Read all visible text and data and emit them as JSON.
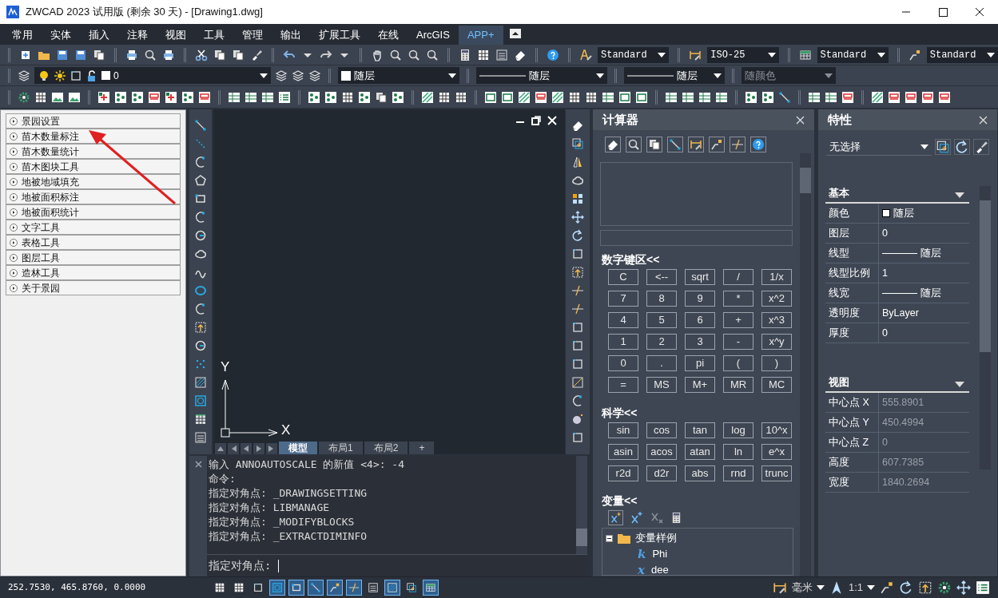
{
  "window": {
    "title": "ZWCAD 2023 试用版 (剩余 30 天) - [Drawing1.dwg]"
  },
  "ribbon_tabs": [
    {
      "label": "常用",
      "selected": false
    },
    {
      "label": "实体",
      "selected": false
    },
    {
      "label": "插入",
      "selected": false
    },
    {
      "label": "注释",
      "selected": false
    },
    {
      "label": "视图",
      "selected": false
    },
    {
      "label": "工具",
      "selected": false
    },
    {
      "label": "管理",
      "selected": false
    },
    {
      "label": "输出",
      "selected": false
    },
    {
      "label": "扩展工具",
      "selected": false
    },
    {
      "label": "在线",
      "selected": false
    },
    {
      "label": "ArcGIS",
      "selected": false
    },
    {
      "label": "APP+",
      "selected": true
    }
  ],
  "style_dropdowns": [
    {
      "value": "Standard"
    },
    {
      "value": "ISO-25"
    },
    {
      "value": "Standard"
    },
    {
      "value": "Standard"
    }
  ],
  "layer_toolbar": {
    "layer": "0",
    "dropdowns": [
      {
        "value": "随层",
        "kind": "color",
        "disabled": false
      },
      {
        "value": "随层",
        "kind": "line",
        "disabled": false
      },
      {
        "value": "随层",
        "kind": "line",
        "disabled": false
      },
      {
        "value": "随颜色",
        "kind": "plain",
        "disabled": true
      }
    ]
  },
  "left_panel": {
    "items": [
      {
        "label": "景园设置"
      },
      {
        "label": "苗木数量标注"
      },
      {
        "label": "苗木数量统计"
      },
      {
        "label": "苗木图块工具"
      },
      {
        "label": "地被地域填充"
      },
      {
        "label": "地被面积标注"
      },
      {
        "label": "地被面积统计"
      },
      {
        "label": "文字工具"
      },
      {
        "label": "表格工具"
      },
      {
        "label": "图层工具"
      },
      {
        "label": "造林工具"
      },
      {
        "label": "关于景园"
      }
    ]
  },
  "drawing": {
    "ucs": {
      "x": "X",
      "y": "Y"
    },
    "layout_tabs": [
      {
        "label": "模型",
        "selected": true
      },
      {
        "label": "布局1",
        "selected": false
      },
      {
        "label": "布局2",
        "selected": false
      },
      {
        "label": "+",
        "selected": false
      }
    ]
  },
  "command_line": {
    "history": [
      "输入 ANNOAUTOSCALE 的新值 <4>: -4",
      "命令:",
      "指定对角点: _DRAWINGSETTING",
      "指定对角点: LIBMANAGE",
      "指定对角点: _MODIFYBLOCKS",
      "指定对角点: _EXTRACTDIMINFO"
    ],
    "prompt": "指定对角点: "
  },
  "calculator": {
    "title": "计算器",
    "keypad": {
      "title": "数字键区<<",
      "keys": [
        "C",
        "<--",
        "sqrt",
        "/",
        "1/x",
        "7",
        "8",
        "9",
        "*",
        "x^2",
        "4",
        "5",
        "6",
        "+",
        "x^3",
        "1",
        "2",
        "3",
        "-",
        "x^y",
        "0",
        ".",
        "pi",
        "(",
        ")",
        "=",
        "MS",
        "M+",
        "MR",
        "MC"
      ]
    },
    "scientific": {
      "title": "科学<<",
      "keys": [
        "sin",
        "cos",
        "tan",
        "log",
        "10^x",
        "asin",
        "acos",
        "atan",
        "ln",
        "e^x",
        "r2d",
        "d2r",
        "abs",
        "rnd",
        "trunc"
      ]
    },
    "variables": {
      "title": "变量<<",
      "tree": [
        {
          "label": "变量样例",
          "expanded": true,
          "children": [
            {
              "label": "Phi",
              "symbol": "k"
            },
            {
              "label": "dee",
              "symbol": "x"
            }
          ]
        }
      ]
    }
  },
  "properties": {
    "title": "特性",
    "selection": "无选择",
    "groups": [
      {
        "title": "基本",
        "read_only": false,
        "rows": [
          {
            "label": "颜色",
            "value": "随层",
            "kind": "color"
          },
          {
            "label": "图层",
            "value": "0",
            "kind": "text"
          },
          {
            "label": "线型",
            "value": "随层",
            "kind": "line"
          },
          {
            "label": "线型比例",
            "value": "1",
            "kind": "text"
          },
          {
            "label": "线宽",
            "value": "随层",
            "kind": "line"
          },
          {
            "label": "透明度",
            "value": "ByLayer",
            "kind": "text"
          },
          {
            "label": "厚度",
            "value": "0",
            "kind": "text"
          }
        ]
      },
      {
        "title": "视图",
        "read_only": true,
        "rows": [
          {
            "label": "中心点 X",
            "value": "555.8901",
            "kind": "text"
          },
          {
            "label": "中心点 Y",
            "value": "450.4994",
            "kind": "text"
          },
          {
            "label": "中心点 Z",
            "value": "0",
            "kind": "text"
          },
          {
            "label": "高度",
            "value": "607.7385",
            "kind": "text"
          },
          {
            "label": "宽度",
            "value": "1840.2694",
            "kind": "text"
          }
        ]
      }
    ]
  },
  "status_bar": {
    "coordinates": "252.7530, 465.8760, 0.0000",
    "toggles": [
      {
        "on": false
      },
      {
        "on": false
      },
      {
        "on": false
      },
      {
        "on": true
      },
      {
        "on": true
      },
      {
        "on": true
      },
      {
        "on": true
      },
      {
        "on": true
      },
      {
        "on": false
      },
      {
        "on": true
      },
      {
        "on": false
      },
      {
        "on": true
      }
    ],
    "units": "毫米",
    "scale": "1:1"
  }
}
